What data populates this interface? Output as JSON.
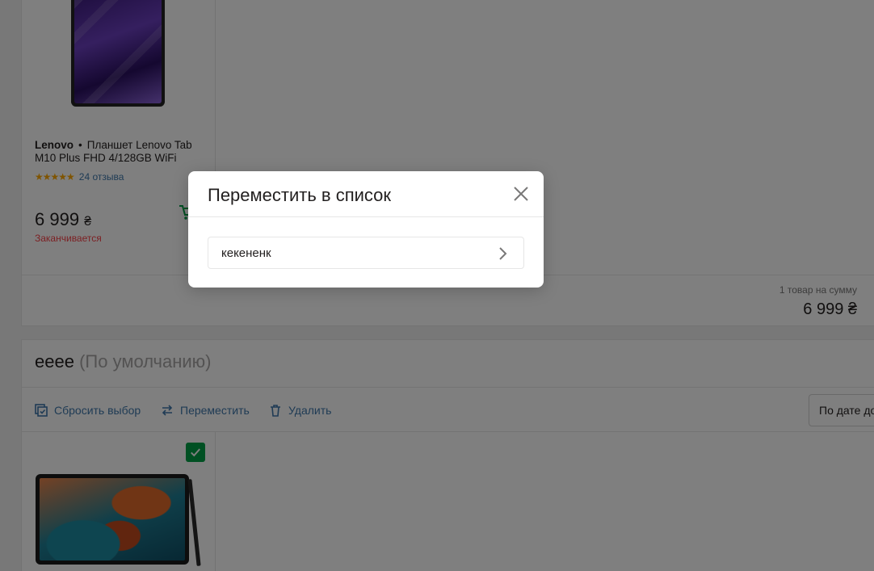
{
  "wishlist_1": {
    "product": {
      "brand": "Lenovo",
      "separator": "•",
      "name": "Планшет Lenovo Tab M10 Plus FHD 4/128GB WiFi",
      "stars": "★★★★★",
      "reviews": "24 отзыва",
      "price": "6 999",
      "currency": "₴",
      "status": "Заканчивается"
    },
    "summary": {
      "label": "1 товар на сумму",
      "total": "6 999 ₴"
    }
  },
  "wishlist_2": {
    "title": "eeee",
    "default_tag": "(По умолчанию)",
    "toolbar": {
      "reset_label": "Сбросить выбор",
      "move_label": "Переместить",
      "delete_label": "Удалить",
      "sort_value": "По дате до"
    }
  },
  "modal": {
    "title": "Переместить в список",
    "options": [
      {
        "label": "кекененк"
      }
    ]
  },
  "colors": {
    "accent_green": "#00a046",
    "link_blue": "#3e77aa",
    "warning_red": "#f84147",
    "star_yellow": "#ffa900"
  }
}
